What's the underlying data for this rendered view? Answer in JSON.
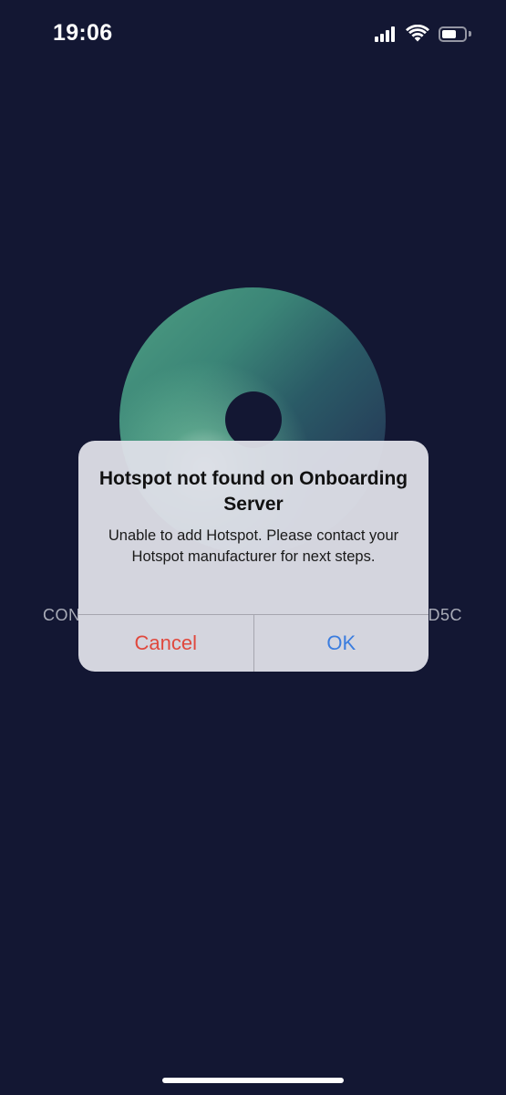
{
  "status_bar": {
    "time": "19:06",
    "battery_level": 0.65
  },
  "background": {
    "left_text": "CON",
    "right_text": "D5C"
  },
  "alert": {
    "title": "Hotspot not found on Onboarding Server",
    "message": "Unable to add Hotspot. Please contact your Hotspot manufacturer for next steps.",
    "cancel_label": "Cancel",
    "ok_label": "OK"
  },
  "colors": {
    "background": "#131733",
    "cancel": "#e0483d",
    "ok": "#3b7ddf"
  }
}
